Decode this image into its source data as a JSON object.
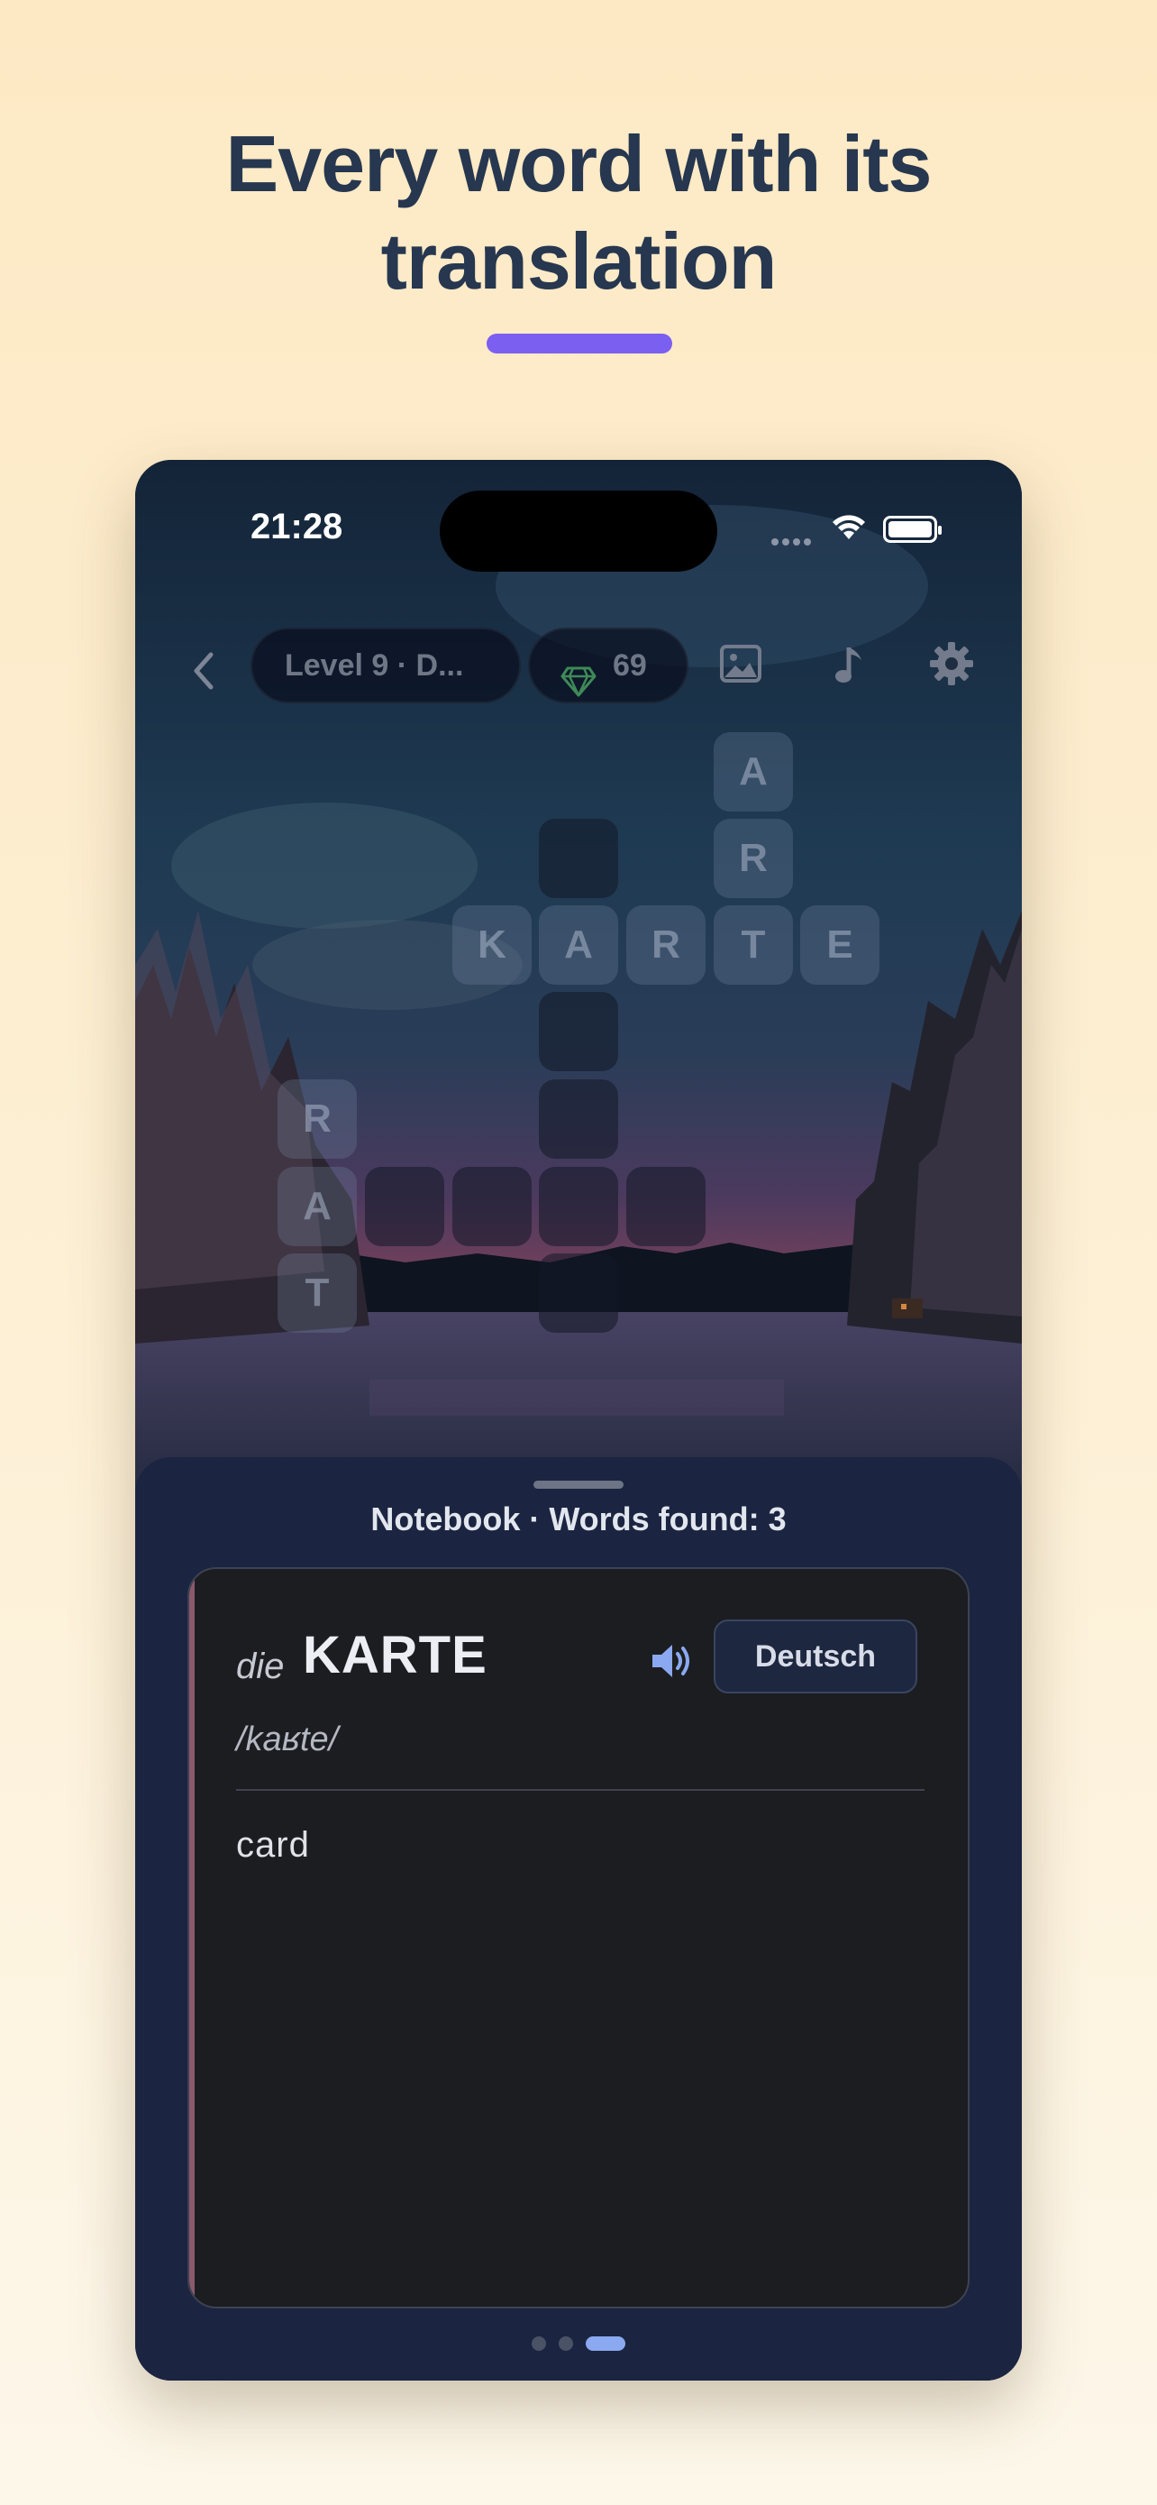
{
  "headline": {
    "line1": "Every word with its",
    "line2": "translation"
  },
  "status_bar": {
    "time": "21:28"
  },
  "toolbar": {
    "level_label": "Level 9 · D...",
    "gems_count": "69",
    "icons": [
      "chevron-left-icon",
      "gem-icon",
      "image-icon",
      "music-note-icon",
      "gear-icon"
    ]
  },
  "puzzle": {
    "words": {
      "vertical_1": [
        "A",
        "R"
      ],
      "horizontal_main": [
        "K",
        "A",
        "R",
        "T",
        "E"
      ],
      "vertical_2": [
        "R",
        "A",
        "T"
      ]
    }
  },
  "notebook": {
    "title": "Notebook · Words found: 3",
    "entry": {
      "article": "die",
      "word": "KARTE",
      "phonetic": "/kaʁte/",
      "language_button": "Deutsch",
      "translation": "card"
    }
  },
  "colors": {
    "headline": "#26374f",
    "accent_bar": "#7b5ff0",
    "sheet_bg": "#1b2440",
    "card_bg": "#1c1d21",
    "pager_active": "#8aa9f0"
  }
}
